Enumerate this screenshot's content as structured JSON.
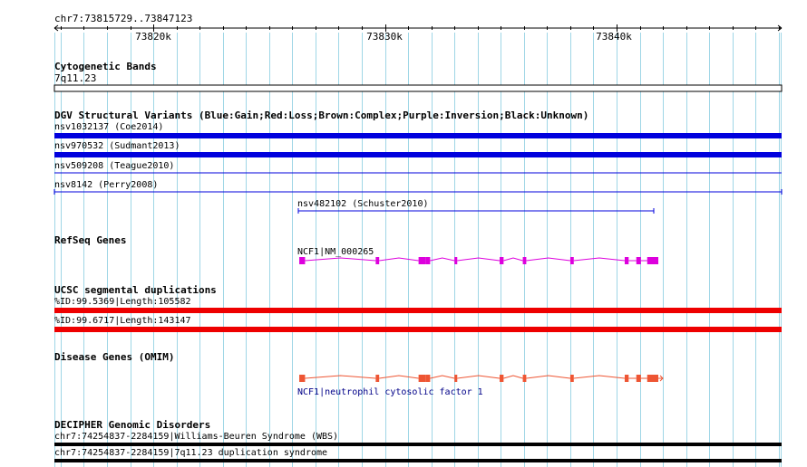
{
  "view": {
    "region_label": "chr7:73815729..73847123",
    "region_start": 73815729,
    "region_end": 73847123
  },
  "ruler": {
    "tick_labels": [
      {
        "pos": 73820000,
        "label": "73820k"
      },
      {
        "pos": 73830000,
        "label": "73830k"
      },
      {
        "pos": 73840000,
        "label": "73840k"
      }
    ]
  },
  "tracks": {
    "cyto": {
      "title": "Cytogenetic Bands",
      "band_label": "7q11.23"
    },
    "dgv": {
      "title": "DGV Structural Variants (Blue:Gain;Red:Loss;Brown:Complex;Purple:Inversion;Black:Unknown)",
      "items": [
        {
          "label": "nsv1032137 (Coe2014)",
          "start": 73815729,
          "end": 73847123,
          "style": "thick"
        },
        {
          "label": "nsv970532 (Sudmant2013)",
          "start": 73815729,
          "end": 73847123,
          "style": "thick"
        },
        {
          "label": "nsv509208 (Teague2010)",
          "start": 73815729,
          "end": 73847123,
          "style": "thin"
        },
        {
          "label": "nsv8142 (Perry2008)",
          "start": 73815729,
          "end": 73847123,
          "style": "thin-ends"
        },
        {
          "label": "nsv482102 (Schuster2010)",
          "start": 73826300,
          "end": 73841800,
          "style": "thin-ends"
        }
      ],
      "color": "#0000dd"
    },
    "refseq": {
      "title": "RefSeq Genes",
      "gene_label": "NCF1|NM_000265",
      "color": "#dd00dd"
    },
    "segdup": {
      "title": "UCSC segmental duplications",
      "items": [
        {
          "label": "%ID:99.5369|Length:105582"
        },
        {
          "label": "%ID:99.6717|Length:143147"
        }
      ],
      "color": "#ee0000"
    },
    "omim": {
      "title": "Disease Genes (OMIM)",
      "gene_label": "NCF1|neutrophil cytosolic factor 1",
      "color": "#ee5533",
      "label_color": "#000088"
    },
    "decipher": {
      "title": "DECIPHER Genomic Disorders",
      "items": [
        {
          "label": "chr7:74254837-2284159|Williams-Beuren Syndrome (WBS)"
        },
        {
          "label": "chr7:74254837-2284159|7q11.23 duplication syndrome"
        }
      ]
    }
  },
  "gene_model": {
    "start": 73826300,
    "end": 73841800,
    "exons": [
      {
        "start": 73826300,
        "end": 73826550
      },
      {
        "start": 73829600,
        "end": 73829750
      },
      {
        "start": 73831450,
        "end": 73831750
      },
      {
        "start": 73831750,
        "end": 73831950
      },
      {
        "start": 73833000,
        "end": 73833120
      },
      {
        "start": 73834950,
        "end": 73835120
      },
      {
        "start": 73835950,
        "end": 73836100
      },
      {
        "start": 73838000,
        "end": 73838150
      },
      {
        "start": 73840350,
        "end": 73840520
      },
      {
        "start": 73840850,
        "end": 73841050
      },
      {
        "start": 73841320,
        "end": 73841800
      }
    ]
  },
  "colors": {
    "grid": "#9fd6e6",
    "text": "#000000",
    "blue_track": "#0000dd",
    "red_track": "#ee0000",
    "black_track": "#000000"
  }
}
